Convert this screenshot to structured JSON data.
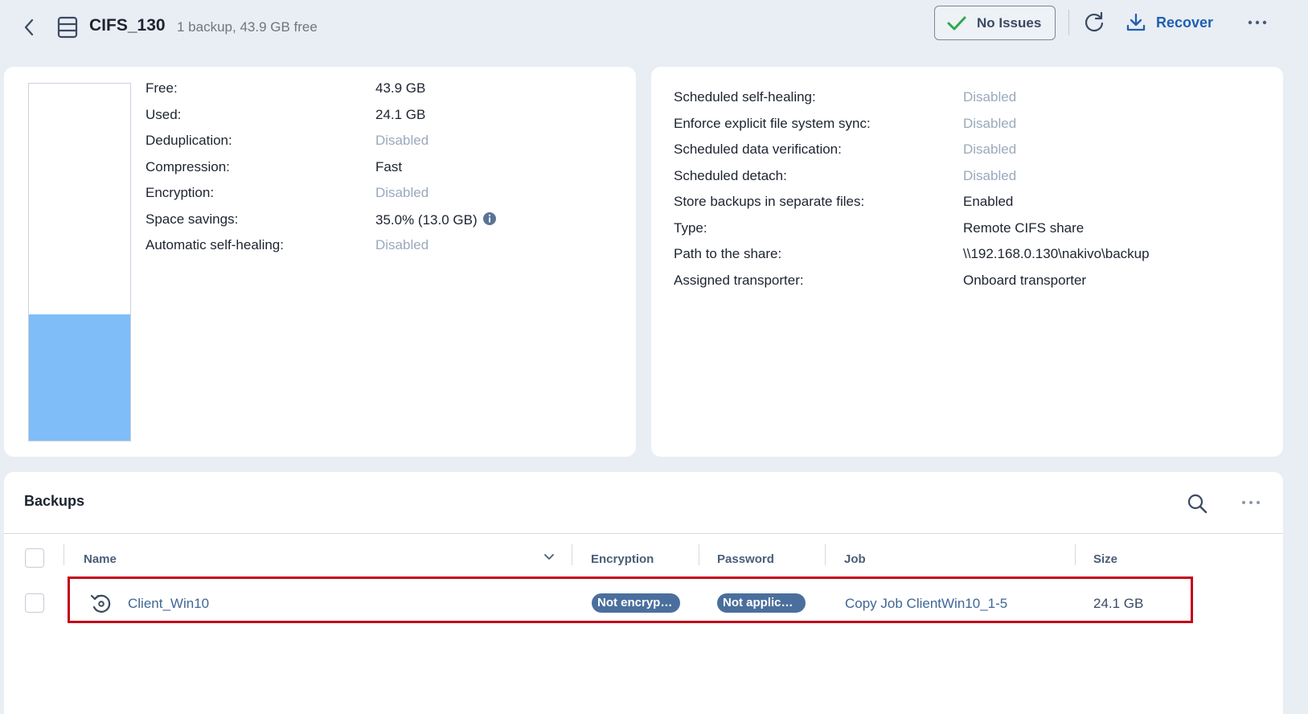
{
  "header": {
    "title": "CIFS_130",
    "subtitle": "1 backup, 43.9 GB free",
    "status_label": "No Issues",
    "recover_label": "Recover"
  },
  "storage": {
    "used_fraction": 0.354,
    "colors": {
      "used": "#7fbdf8",
      "free": "#ffffff"
    }
  },
  "left_props": [
    {
      "label": "Free:",
      "value": "43.9 GB",
      "dim": false
    },
    {
      "label": "Used:",
      "value": "24.1 GB",
      "dim": false
    },
    {
      "label": "Deduplication:",
      "value": "Disabled",
      "dim": true
    },
    {
      "label": "Compression:",
      "value": "Fast",
      "dim": false
    },
    {
      "label": "Encryption:",
      "value": "Disabled",
      "dim": true
    },
    {
      "label": "Space savings:",
      "value": "35.0% (13.0 GB)",
      "dim": false,
      "info": true
    },
    {
      "label": "Automatic self-healing:",
      "value": "Disabled",
      "dim": true
    }
  ],
  "right_props": [
    {
      "label": "Scheduled self-healing:",
      "value": "Disabled",
      "dim": true
    },
    {
      "label": "Enforce explicit file system sync:",
      "value": "Disabled",
      "dim": true
    },
    {
      "label": "Scheduled data verification:",
      "value": "Disabled",
      "dim": true
    },
    {
      "label": "Scheduled detach:",
      "value": "Disabled",
      "dim": true
    },
    {
      "label": "Store backups in separate files:",
      "value": "Enabled",
      "dim": false
    },
    {
      "label": "Type:",
      "value": "Remote CIFS share",
      "dim": false
    },
    {
      "label": "Path to the share:",
      "value": "\\\\192.168.0.130\\nakivo\\backup",
      "dim": false
    },
    {
      "label": "Assigned transporter:",
      "value": "Onboard transporter",
      "dim": false
    }
  ],
  "backups": {
    "title": "Backups",
    "columns": {
      "name": "Name",
      "encryption": "Encryption",
      "password": "Password",
      "job": "Job",
      "size": "Size"
    },
    "rows": [
      {
        "name": "Client_Win10",
        "encryption": "Not encryp…",
        "password": "Not applic…",
        "job": "Copy Job ClientWin10_1-5",
        "size": "24.1 GB"
      }
    ]
  },
  "icons": {
    "back": "chevron-left-icon",
    "repository": "repository-icon",
    "status": "checkmark-icon",
    "refresh": "refresh-icon",
    "recover": "download-icon",
    "more": "more-dots-icon",
    "info": "info-icon",
    "search": "search-icon",
    "backup": "backup-restore-icon",
    "sort": "chevron-down-icon"
  },
  "colors": {
    "accent": "#1f5fb0",
    "status_check": "#2fa84f",
    "disabled_text": "#9aa9bd",
    "pill_bg": "#4b6f9d",
    "highlight_border": "#c4001a"
  }
}
